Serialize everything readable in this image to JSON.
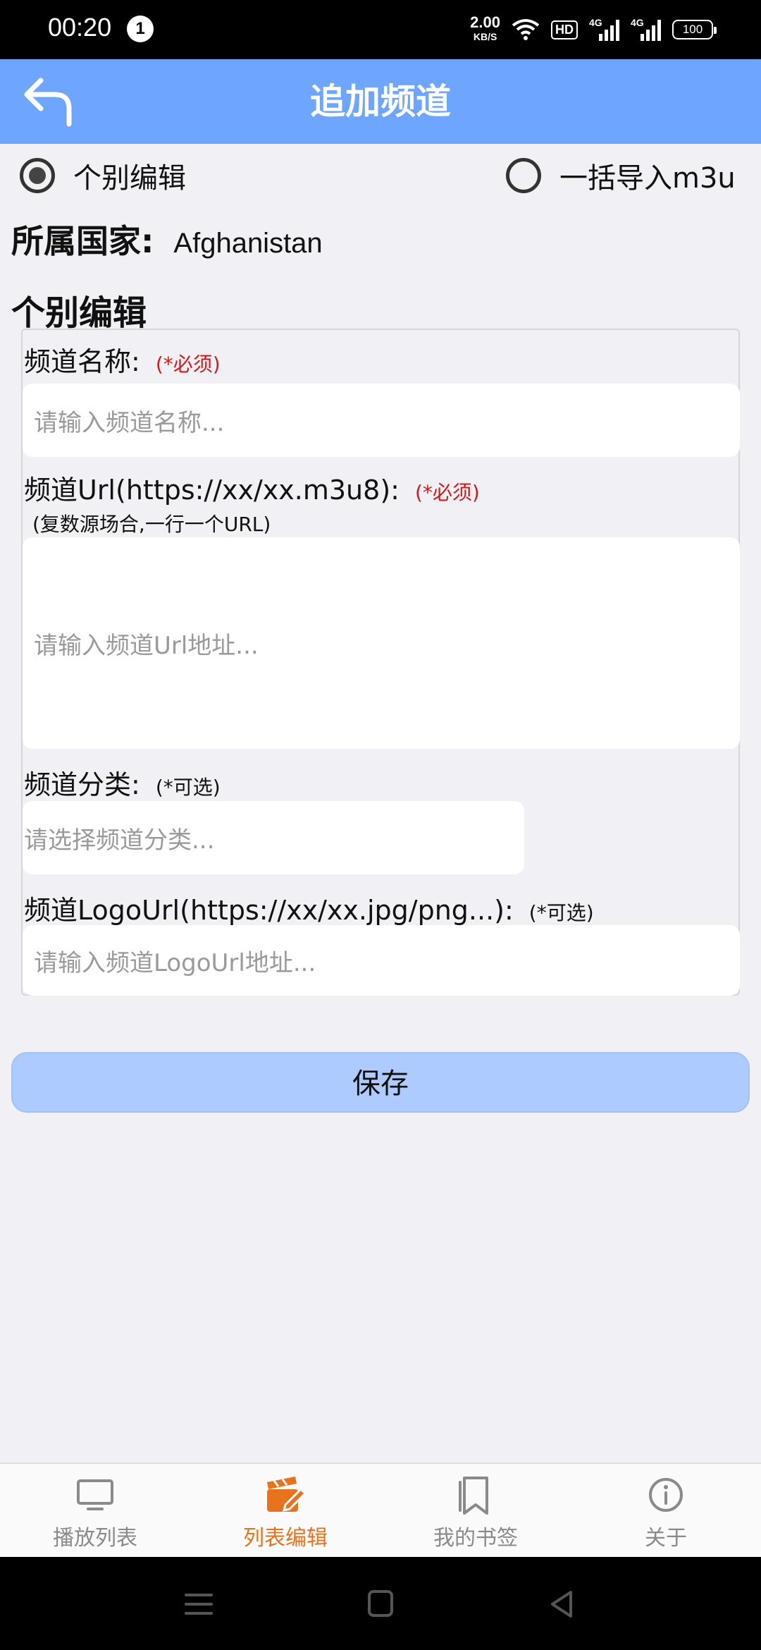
{
  "status_bar": {
    "time": "00:20",
    "notification_count": "1",
    "net_speed_value": "2.00",
    "net_speed_unit": "KB/S",
    "hd_badge": "HD",
    "signal1_label": "4G",
    "signal2_label": "4G",
    "battery": "100"
  },
  "app_bar": {
    "title": "追加频道",
    "back_icon": "back-arrow-icon",
    "background": "#6ea6ff"
  },
  "mode": {
    "option_single": "个别编辑",
    "option_bulk": "一括导入m3u",
    "selected": "个别编辑"
  },
  "country": {
    "label": "所属国家:",
    "value": "Afghanistan"
  },
  "section_title": "个别编辑",
  "form": {
    "name": {
      "label": "频道名称:",
      "required": "(*必须)",
      "placeholder": "请输入频道名称..."
    },
    "url": {
      "label": "频道Url(https://xx/xx.m3u8):",
      "required": "(*必须)",
      "hint": "(复数源场合,一行一个URL)",
      "placeholder": "请输入频道Url地址..."
    },
    "category": {
      "label": "频道分类:",
      "optional": "(*可选)",
      "placeholder": "请选择频道分类..."
    },
    "logo": {
      "label": "频道LogoUrl(https://xx/xx.jpg/png...):",
      "optional": "(*可选)",
      "placeholder": "请输入频道LogoUrl地址..."
    }
  },
  "save_button": "保存",
  "bottom_nav": {
    "items": [
      {
        "label": "播放列表",
        "icon": "tv-icon"
      },
      {
        "label": "列表编辑",
        "icon": "clapperboard-edit-icon",
        "active": true
      },
      {
        "label": "我的书签",
        "icon": "bookmark-icon"
      },
      {
        "label": "关于",
        "icon": "info-icon"
      }
    ],
    "active_color": "#e8731e"
  }
}
